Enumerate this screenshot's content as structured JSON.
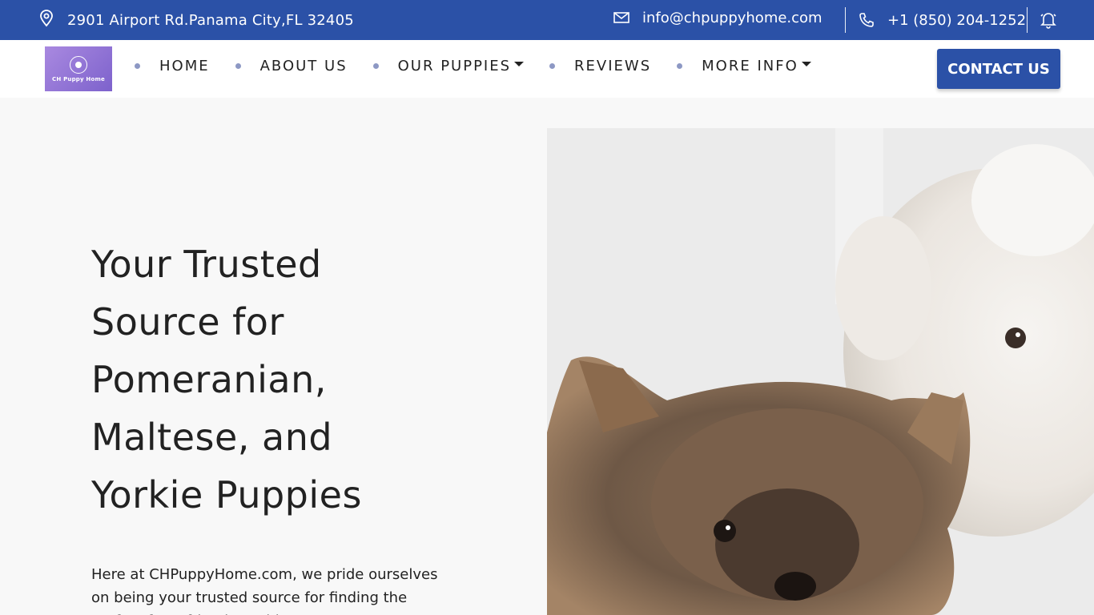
{
  "topbar": {
    "address": "2901 Airport Rd.Panama City,FL 32405",
    "email": "info@chpuppyhome.com",
    "phone": "+1 (850) 204-1252"
  },
  "logo": {
    "text": "CH Puppy Home"
  },
  "nav": {
    "items": [
      {
        "label": "HOME",
        "has_dropdown": false
      },
      {
        "label": "ABOUT US",
        "has_dropdown": false
      },
      {
        "label": "OUR PUPPIES",
        "has_dropdown": true
      },
      {
        "label": "REVIEWS",
        "has_dropdown": false
      },
      {
        "label": "MORE INFO",
        "has_dropdown": true
      }
    ],
    "cta": "CONTACT US"
  },
  "hero": {
    "title_lines": [
      "Your Trusted",
      "Source for",
      "Pomeranian,",
      "Maltese, and",
      "Yorkie Puppies"
    ],
    "text": "Here at CHPuppyHome.com, we pride ourselves on being your trusted source for finding the perfect furry friend to add to"
  },
  "colors": {
    "brand": "#2b51a7",
    "accent_dot": "#8d98c4",
    "logo": "#8f74d6"
  },
  "icons": [
    "map-pin-icon",
    "mail-icon",
    "phone-icon",
    "bell-icon"
  ]
}
